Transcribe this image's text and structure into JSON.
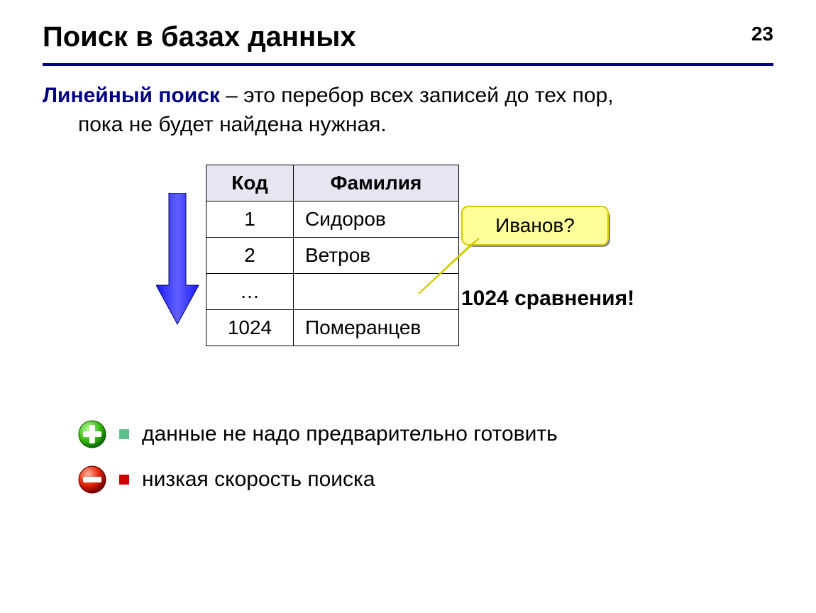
{
  "page_number": "23",
  "title": "Поиск в базах данных",
  "definition": {
    "term": "Линейный поиск",
    "line1_rest": " – это перебор всех записей до тех пор,",
    "line2": "пока не будет найдена нужная."
  },
  "table": {
    "headers": {
      "code": "Код",
      "name": "Фамилия"
    },
    "rows": [
      {
        "code": "1",
        "name": "Сидоров"
      },
      {
        "code": "2",
        "name": "Ветров"
      },
      {
        "code": "…",
        "name": ""
      },
      {
        "code": "1024",
        "name": "Померанцев"
      }
    ]
  },
  "callout": "Иванов?",
  "comparisons": "1024 сравнения!",
  "bullets": {
    "pro": "данные не надо предварительно готовить",
    "con": "низкая скорость поиска"
  }
}
